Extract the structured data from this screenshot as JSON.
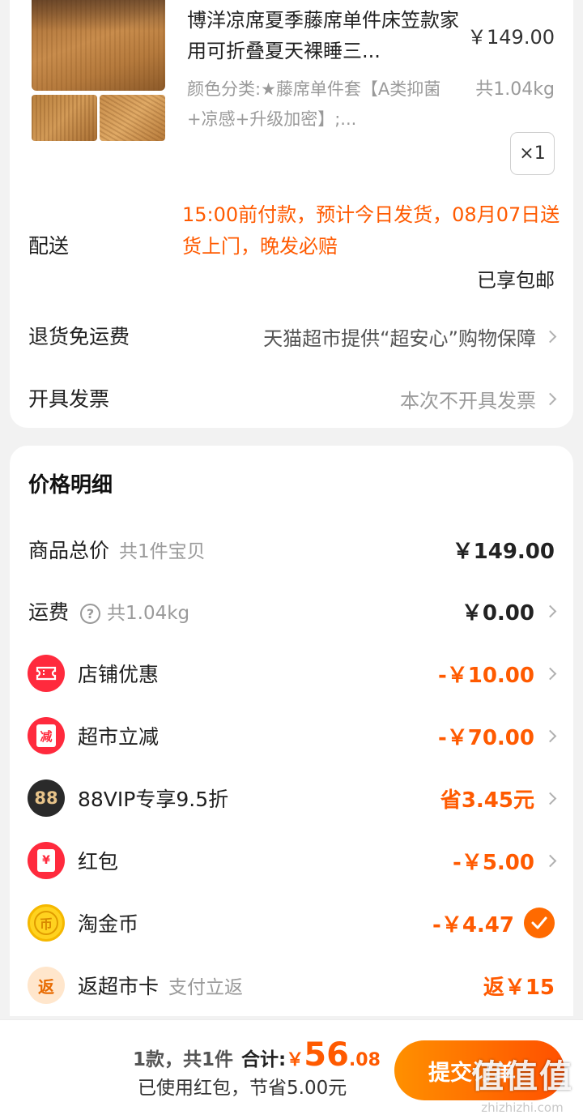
{
  "product": {
    "title": "博洋凉席夏季藤席单件床笠款家用可折叠夏天裸睡三...",
    "price": "￥149.00",
    "sku": "颜色分类:★藤席单件套【A类抑菌+凉感+升级加密】;...",
    "weight": "共1.04kg",
    "quantity": "×1"
  },
  "shipping": {
    "delivery_label": "配送",
    "delivery_text": "15:00前付款，预计今日发货，08月07日送货上门，晚发必赔",
    "free_shipping": "已享包邮",
    "return_label": "退货免运费",
    "return_value": "天猫超市提供“超安心”购物保障",
    "invoice_label": "开具发票",
    "invoice_value": "本次不开具发票"
  },
  "price_details": {
    "title": "价格明细",
    "goods_total": {
      "label": "商品总价",
      "sub": "共1件宝贝",
      "amount": "￥149.00"
    },
    "freight": {
      "label": "运费",
      "help": "?",
      "sub": "共1.04kg",
      "amount": "￥0.00"
    },
    "store_discount": {
      "label": "店铺优惠",
      "amount": "-￥10.00",
      "icon": "store-coupon-icon"
    },
    "market_discount": {
      "label": "超市立减",
      "icon_text": "减",
      "amount": "-￥70.00"
    },
    "vip": {
      "label": "88VIP专享9.5折",
      "icon_text": "88",
      "amount": "省3.45元"
    },
    "red_packet": {
      "label": "红包",
      "icon_text": "¥",
      "amount": "-￥5.00"
    },
    "coins": {
      "label": "淘金币",
      "icon_text": "币",
      "amount": "-￥4.47"
    },
    "cashback": {
      "label": "返超市卡",
      "sub": "支付立返",
      "icon_text": "返",
      "amount": "返￥15"
    }
  },
  "bottom": {
    "count": "1款，共1件",
    "total_label": "合计:",
    "currency": "￥",
    "total_int": "56",
    "total_dec": ".08",
    "saved": "已使用红包，节省5.00元",
    "submit": "提交订单",
    "watermark": "值值值",
    "watermark_sub": "zhizhizhi.com"
  },
  "colors": {
    "accent": "#ff5a00",
    "button_start": "#ff9000",
    "button_end": "#ff5000"
  }
}
